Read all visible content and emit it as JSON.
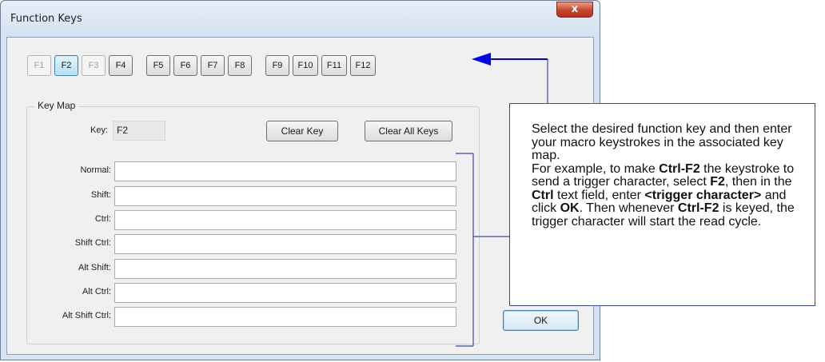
{
  "window": {
    "title": "Function Keys",
    "close_glyph": "x"
  },
  "function_keys": [
    {
      "label": "F1",
      "state": "disabled"
    },
    {
      "label": "F2",
      "state": "selected"
    },
    {
      "label": "F3",
      "state": "disabled"
    },
    {
      "label": "F4",
      "state": "normal"
    },
    {
      "label": "F5",
      "state": "normal"
    },
    {
      "label": "F6",
      "state": "normal"
    },
    {
      "label": "F7",
      "state": "normal"
    },
    {
      "label": "F8",
      "state": "normal"
    },
    {
      "label": "F9",
      "state": "normal"
    },
    {
      "label": "F10",
      "state": "normal"
    },
    {
      "label": "F11",
      "state": "normal"
    },
    {
      "label": "F12",
      "state": "normal"
    }
  ],
  "key_map": {
    "group_label": "Key Map",
    "key_label": "Key:",
    "key_value": "F2",
    "clear_key_label": "Clear Key",
    "clear_all_label": "Clear All Keys",
    "fields": [
      {
        "label": "Normal:",
        "value": ""
      },
      {
        "label": "Shift:",
        "value": ""
      },
      {
        "label": "Ctrl:",
        "value": ""
      },
      {
        "label": "Shift Ctrl:",
        "value": ""
      },
      {
        "label": "Alt Shift:",
        "value": ""
      },
      {
        "label": "Alt Ctrl:",
        "value": ""
      },
      {
        "label": "Alt Shift Ctrl:",
        "value": ""
      }
    ]
  },
  "ok_label": "OK",
  "callout": {
    "intro": "Select the desired function key and then enter your macro keystrokes in the associated key map.",
    "p1": "For example, to make ",
    "b1": "Ctrl-F2",
    "p2": " the keystroke to send a trigger character, select ",
    "b2": "F2",
    "p3": ", then in the ",
    "b3": "Ctrl",
    "p4": " text field, enter ",
    "b4": "<trigger character>",
    "p5": " and click ",
    "b5": "OK",
    "p6": ". Then whenever ",
    "b6": "Ctrl-F2",
    "p7": " is keyed, the trigger character will start the read cycle."
  },
  "colors": {
    "callout_border": "#3f45a8",
    "arrow": "#0000ee",
    "connector": "#3f45a8"
  }
}
